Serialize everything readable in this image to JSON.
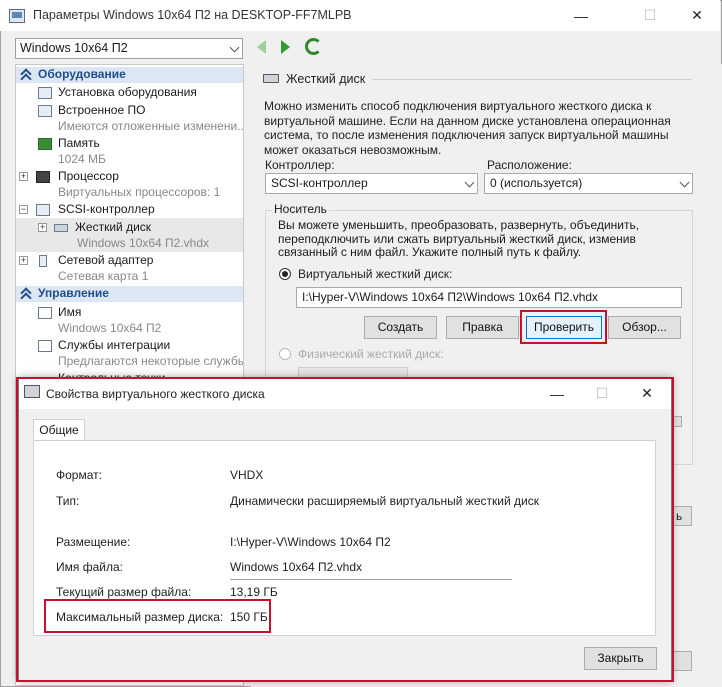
{
  "window": {
    "title": "Параметры Windows 10x64 П2 на DESKTOP-FF7MLPB",
    "minimize": "—",
    "maximize": "☐",
    "close": "✕"
  },
  "toolbar": {
    "vm_selected": "Windows 10x64 П2"
  },
  "tree": {
    "hardware_header": "Оборудование",
    "add_hardware": "Установка оборудования",
    "firmware": "Встроенное ПО",
    "firmware_sub": "Имеются отложенные изменени...",
    "memory": "Память",
    "memory_sub": "1024 МБ",
    "processor": "Процессор",
    "processor_sub": "Виртуальных процессоров: 1",
    "scsi": "SCSI-контроллер",
    "hdd": "Жесткий диск",
    "hdd_sub": "Windows 10x64 П2.vhdx",
    "network": "Сетевой адаптер",
    "network_sub": "Сетевая карта 1",
    "management_header": "Управление",
    "name": "Имя",
    "name_sub": "Windows 10x64 П2",
    "integration": "Службы интеграции",
    "integration_sub": "Предлагаются некоторые службы",
    "checkpoints_partial": "Контрольные точки"
  },
  "details": {
    "section_title": "Жесткий диск",
    "intro": "Можно изменить способ подключения виртуального жесткого диска к виртуальной машине. Если на данном диске установлена операционная система, то после изменения подключения запуск виртуальной машины может оказаться невозможным.",
    "controller_label": "Контроллер:",
    "controller_value": "SCSI-контроллер",
    "location_label": "Расположение:",
    "location_value": "0 (используется)",
    "media_label": "Носитель",
    "media_text": "Вы можете уменьшить, преобразовать, развернуть, объединить, переподключить или сжать виртуальный жесткий диск, изменив связанный с ним файл. Укажите полный путь к файлу.",
    "virtual_disk_label": "Виртуальный жесткий диск:",
    "virtual_disk_path": "I:\\Hyper-V\\Windows 10x64 П2\\Windows 10x64 П2.vhdx",
    "btn_new": "Создать",
    "btn_edit": "Правка",
    "btn_inspect": "Проверить",
    "btn_browse": "Обзор...",
    "physical_disk_label": "Физический жесткий диск:",
    "partial_btn": "ь"
  },
  "dialog": {
    "title": "Свойства виртуального жесткого диска",
    "minimize": "—",
    "maximize": "☐",
    "close": "✕",
    "tab_general": "Общие",
    "format_label": "Формат:",
    "format_value": "VHDX",
    "type_label": "Тип:",
    "type_value": "Динамически расширяемый виртуальный жесткий диск",
    "location_label": "Размещение:",
    "location_value": "I:\\Hyper-V\\Windows 10x64 П2",
    "filename_label": "Имя файла:",
    "filename_value": "Windows 10x64 П2.vhdx",
    "current_size_label": "Текущий размер файла:",
    "current_size_value": "13,19 ГБ",
    "max_size_label": "Максимальный размер диска:",
    "max_size_value": "150 ГБ",
    "close_button": "Закрыть"
  },
  "colors": {
    "highlight": "#c8102e",
    "header_blue": "#1f4e8c",
    "focus_blue": "#0078d7"
  }
}
